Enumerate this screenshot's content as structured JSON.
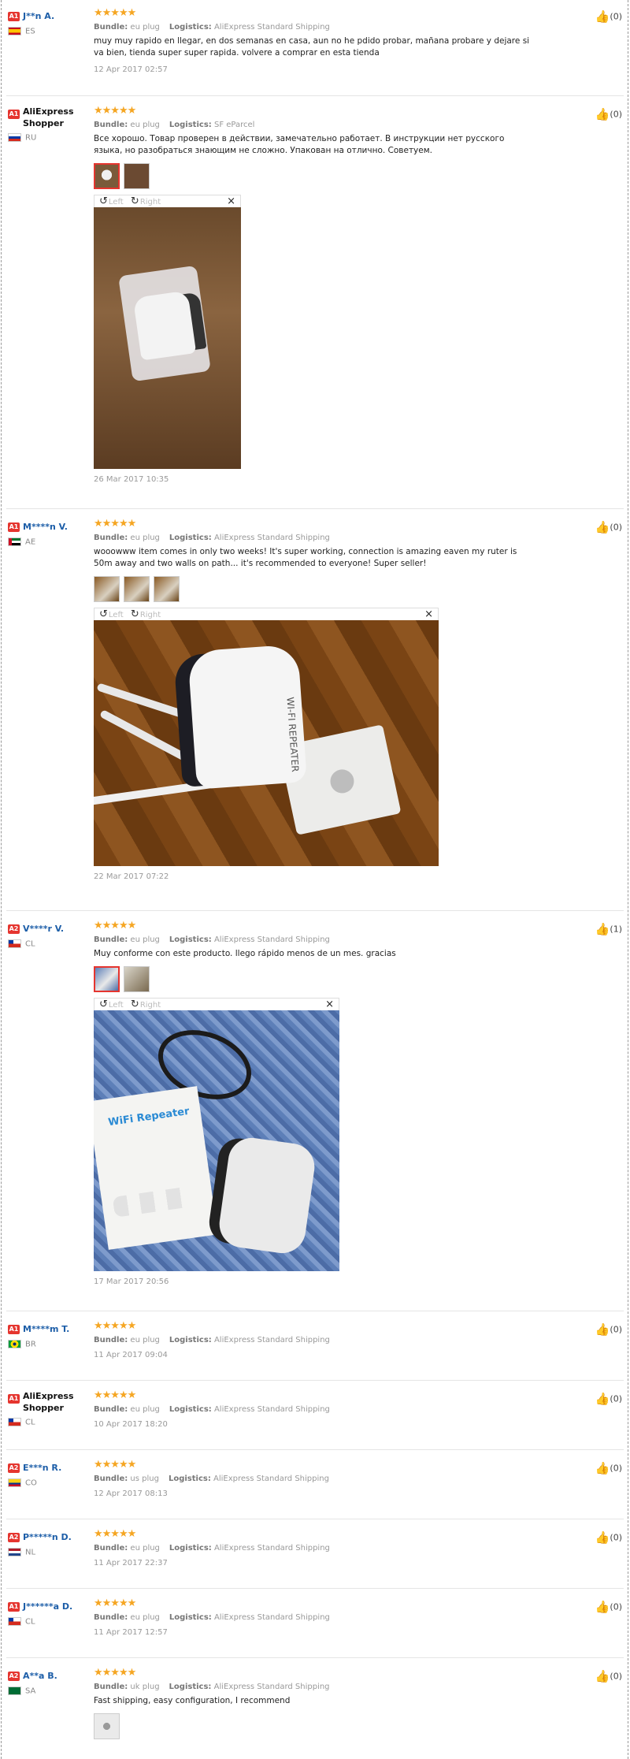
{
  "labels": {
    "bundle": "Bundle:",
    "logistics": "Logistics:",
    "rotate_left": "Left",
    "rotate_right": "Right",
    "close": "×"
  },
  "reviews": [
    {
      "level": "A1",
      "name": "J**n A.",
      "country": "ES",
      "stars": 5,
      "bundle": "eu plug",
      "logistics": "AliExpress Standard Shipping",
      "text": "muy muy rapido en llegar, en dos semanas en casa, aun no he pdido probar, mañana probare y dejare si va bien, tienda super super rapida. volvere a comprar en esta tienda",
      "date": "12 Apr 2017 02:57",
      "likes": "(0)"
    },
    {
      "level": "A1",
      "name": "AliExpress Shopper",
      "country": "RU",
      "stars": 5,
      "bundle": "eu plug",
      "logistics": "SF eParcel",
      "text": "Все хорошо. Товар проверен в действии, замечательно работает. В инструкции нет русского языка, но разобраться знающим не сложно. Упакован на отлично. Советуем.",
      "date": "26 Mar 2017 10:35",
      "likes": "(0)"
    },
    {
      "level": "A1",
      "name": "M****n V.",
      "country": "AE",
      "stars": 5,
      "bundle": "eu plug",
      "logistics": "AliExpress Standard Shipping",
      "text": "wooowww item comes in only two weeks! It's super working, connection is amazing eaven my ruter is 50m away and two walls on path... it's recommended to everyone! Super seller!",
      "date": "22 Mar 2017 07:22",
      "likes": "(0)",
      "photo_text": "WI-FI REPEATER"
    },
    {
      "level": "A2",
      "name": "V****r V.",
      "country": "CL",
      "stars": 5,
      "bundle": "eu plug",
      "logistics": "AliExpress Standard Shipping",
      "text": "Muy conforme con este producto. llego rápido menos de un mes. gracias",
      "date": "17 Mar 2017 20:56",
      "likes": "(1)",
      "photo_text": "WiFi Repeater"
    },
    {
      "level": "A1",
      "name": "M****m T.",
      "country": "BR",
      "stars": 5,
      "bundle": "eu plug",
      "logistics": "AliExpress Standard Shipping",
      "date": "11 Apr 2017 09:04",
      "likes": "(0)"
    },
    {
      "level": "A1",
      "name": "AliExpress Shopper",
      "country": "CL",
      "stars": 5,
      "bundle": "eu plug",
      "logistics": "AliExpress Standard Shipping",
      "date": "10 Apr 2017 18:20",
      "likes": "(0)"
    },
    {
      "level": "A2",
      "name": "E***n R.",
      "country": "CO",
      "stars": 5,
      "bundle": "us plug",
      "logistics": "AliExpress Standard Shipping",
      "date": "12 Apr 2017 08:13",
      "likes": "(0)"
    },
    {
      "level": "A2",
      "name": "P*****n D.",
      "country": "NL",
      "stars": 5,
      "bundle": "eu plug",
      "logistics": "AliExpress Standard Shipping",
      "date": "11 Apr 2017 22:37",
      "likes": "(0)"
    },
    {
      "level": "A1",
      "name": "J******a D.",
      "country": "CL",
      "stars": 5,
      "bundle": "eu plug",
      "logistics": "AliExpress Standard Shipping",
      "date": "11 Apr 2017 12:57",
      "likes": "(0)"
    },
    {
      "level": "A2",
      "name": "A**a B.",
      "country": "SA",
      "stars": 5,
      "bundle": "uk plug",
      "logistics": "AliExpress Standard Shipping",
      "text": "Fast shipping, easy configuration, I recommend",
      "likes": "(0)"
    }
  ],
  "star_glyph": "★★★★★",
  "icons": {
    "like": "thumbs-up-icon",
    "rotate_left": "rotate-left-icon",
    "rotate_right": "rotate-right-icon",
    "close": "close-icon"
  },
  "colors": {
    "accent": "#e5352f",
    "star": "#f5a623",
    "link": "#1d5ea8"
  }
}
